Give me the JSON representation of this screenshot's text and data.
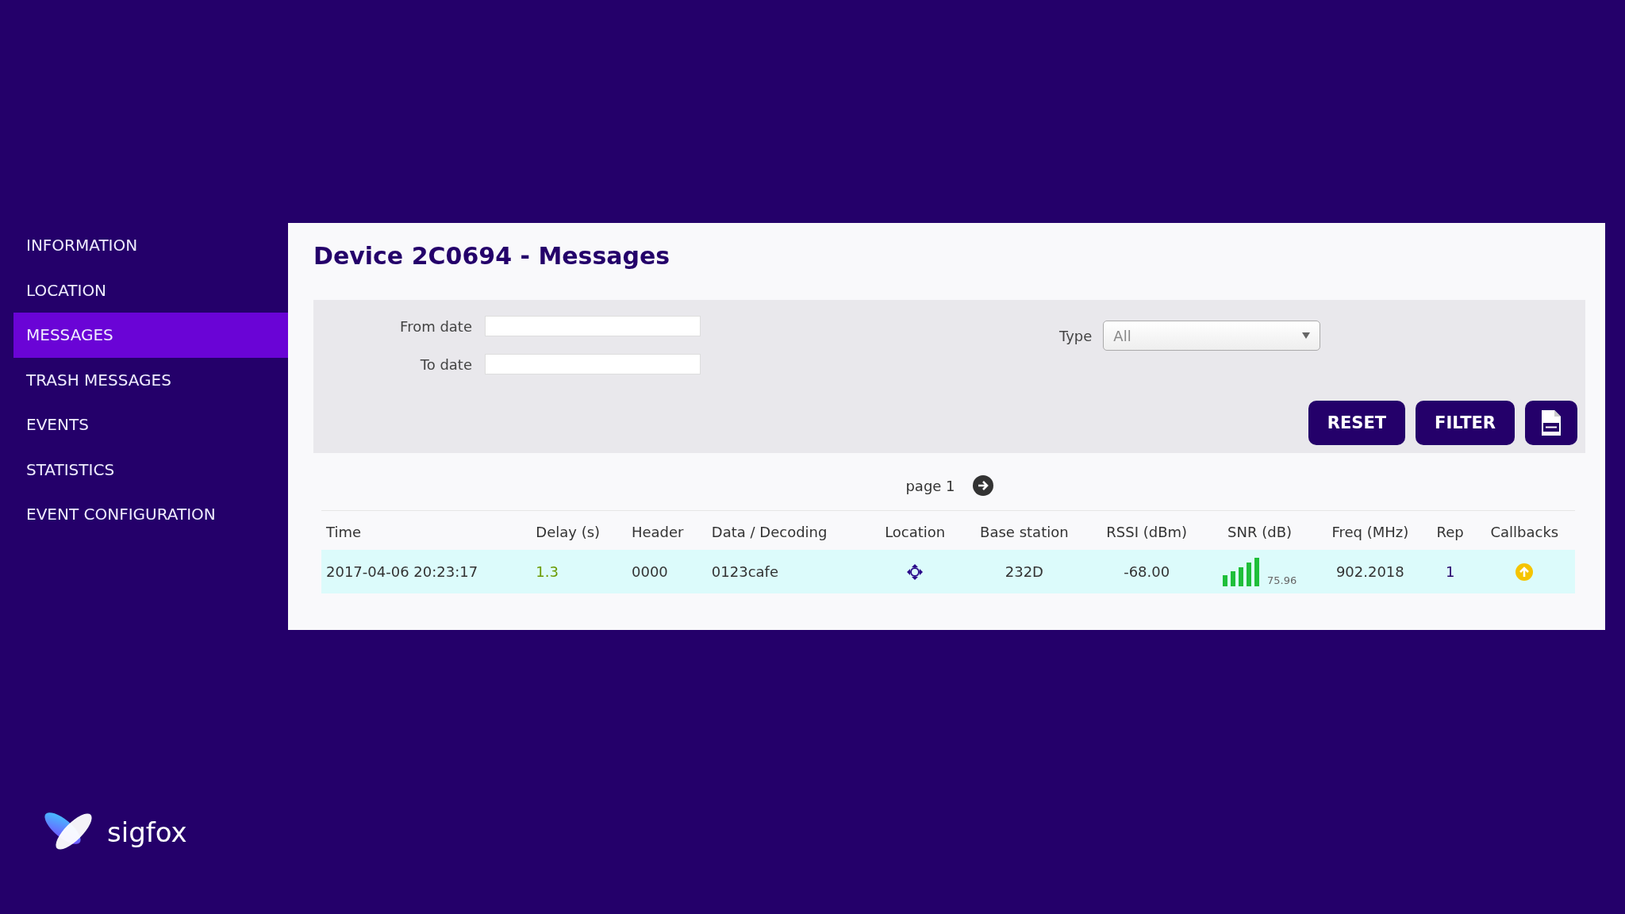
{
  "sidebar": {
    "items": [
      {
        "label": "INFORMATION",
        "selected": false
      },
      {
        "label": "LOCATION",
        "selected": false
      },
      {
        "label": "MESSAGES",
        "selected": true
      },
      {
        "label": "TRASH MESSAGES",
        "selected": false
      },
      {
        "label": "EVENTS",
        "selected": false
      },
      {
        "label": "STATISTICS",
        "selected": false
      },
      {
        "label": "EVENT CONFIGURATION",
        "selected": false
      }
    ]
  },
  "page_title": "Device 2C0694 - Messages",
  "filters": {
    "from_date": {
      "label": "From date"
    },
    "to_date": {
      "label": "To date"
    },
    "type": {
      "label": "Type",
      "value": "All"
    },
    "buttons": [
      "RESET",
      "FILTER"
    ]
  },
  "pagination": {
    "label": "page 1"
  },
  "table": {
    "columns": [
      "Time",
      "Delay (s)",
      "Header",
      "Data / Decoding",
      "Location",
      "Base station",
      "RSSI (dBm)",
      "SNR (dB)",
      "Freq (MHz)",
      "Rep",
      "Callbacks"
    ],
    "rows": [
      {
        "time": "2017-04-06 20:23:17",
        "delay": "1.3",
        "header": "0000",
        "data": "0123cafe",
        "base_station": "232D",
        "rssi": "-68.00",
        "snr": "75.96",
        "freq": "902.2018",
        "rep": "1"
      }
    ]
  },
  "logo": {
    "text": "sigfox"
  }
}
